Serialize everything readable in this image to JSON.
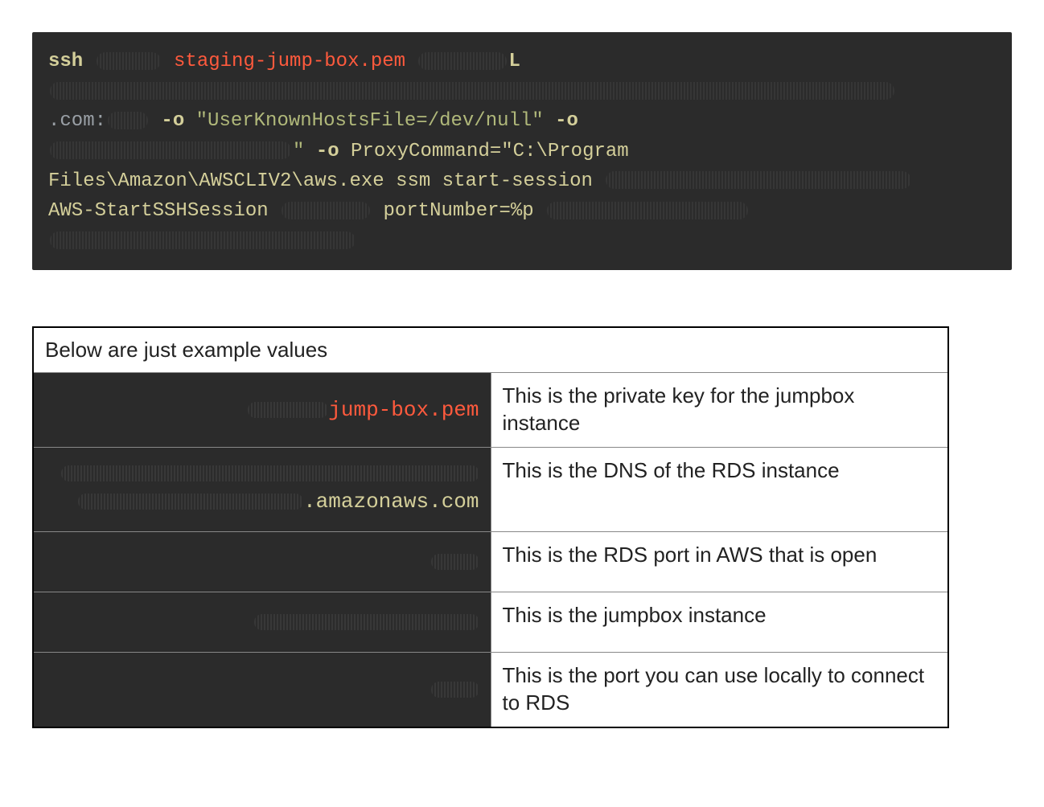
{
  "code": {
    "tokens": {
      "ssh": "ssh",
      "pem_file": "staging-jump-box.pem",
      "L_flag": "L",
      "dot_com": ".com:",
      "o_flag_1": "-o",
      "hostsfile": "\"UserKnownHostsFile=/dev/null\"",
      "o_flag_2": "-o",
      "quote_close": "\"",
      "o_flag_3": "-o",
      "proxycmd_pre": "ProxyCommand=\"C:\\Program",
      "proxycmd_rest": "Files\\Amazon\\AWSCLIV2\\aws.exe ssm start-session",
      "session_doc": "AWS-StartSSHSession",
      "port_param": "portNumber=%p"
    }
  },
  "examples": {
    "caption": "Below are just example values",
    "rows": [
      {
        "value": "jump-box.pem",
        "desc": "This is the private key for the jumpbox instance"
      },
      {
        "value": ".amazonaws.com",
        "desc": "This is the DNS of the RDS instance"
      },
      {
        "value": "",
        "desc": "This is the RDS port in AWS that is open"
      },
      {
        "value": "",
        "desc": "This is the jumpbox instance"
      },
      {
        "value": "",
        "desc": "This is the port you can use locally to connect to RDS"
      }
    ]
  }
}
